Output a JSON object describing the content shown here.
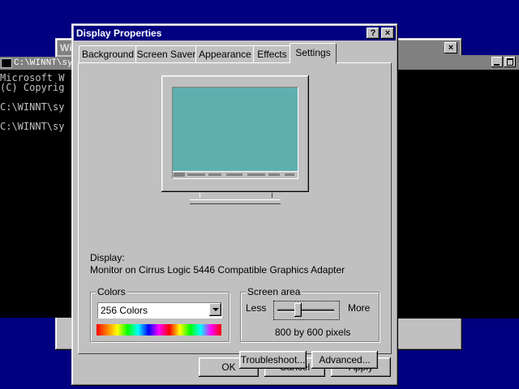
{
  "background_windows": {
    "cmd_title": "C:\\WINNT\\sy",
    "cmd_lines": [
      "Microsoft W",
      "(C) Copyrig",
      "",
      "C:\\WINNT\\sy",
      "",
      "C:\\WINNT\\sy"
    ],
    "behind_title_fragment": "Wi"
  },
  "dialog": {
    "title": "Display Properties",
    "help_label": "?",
    "close_label": "×",
    "tabs": [
      "Background",
      "Screen Saver",
      "Appearance",
      "Effects",
      "Settings"
    ],
    "active_tab": "Settings"
  },
  "settings": {
    "display_label": "Display:",
    "adapter": "Monitor on Cirrus Logic 5446 Compatible Graphics Adapter",
    "colors_group": "Colors",
    "colors_value": "256 Colors",
    "screen_area_group": "Screen area",
    "less_label": "Less",
    "more_label": "More",
    "resolution": "800 by 600 pixels",
    "slider_position": 0.35,
    "preview_desktop_color": "#5fafaf",
    "troubleshoot_label": "Troubleshoot...",
    "advanced_label": "Advanced..."
  },
  "footer": {
    "ok_label": "OK",
    "cancel_label": "Cancel",
    "apply_label": "Apply"
  }
}
